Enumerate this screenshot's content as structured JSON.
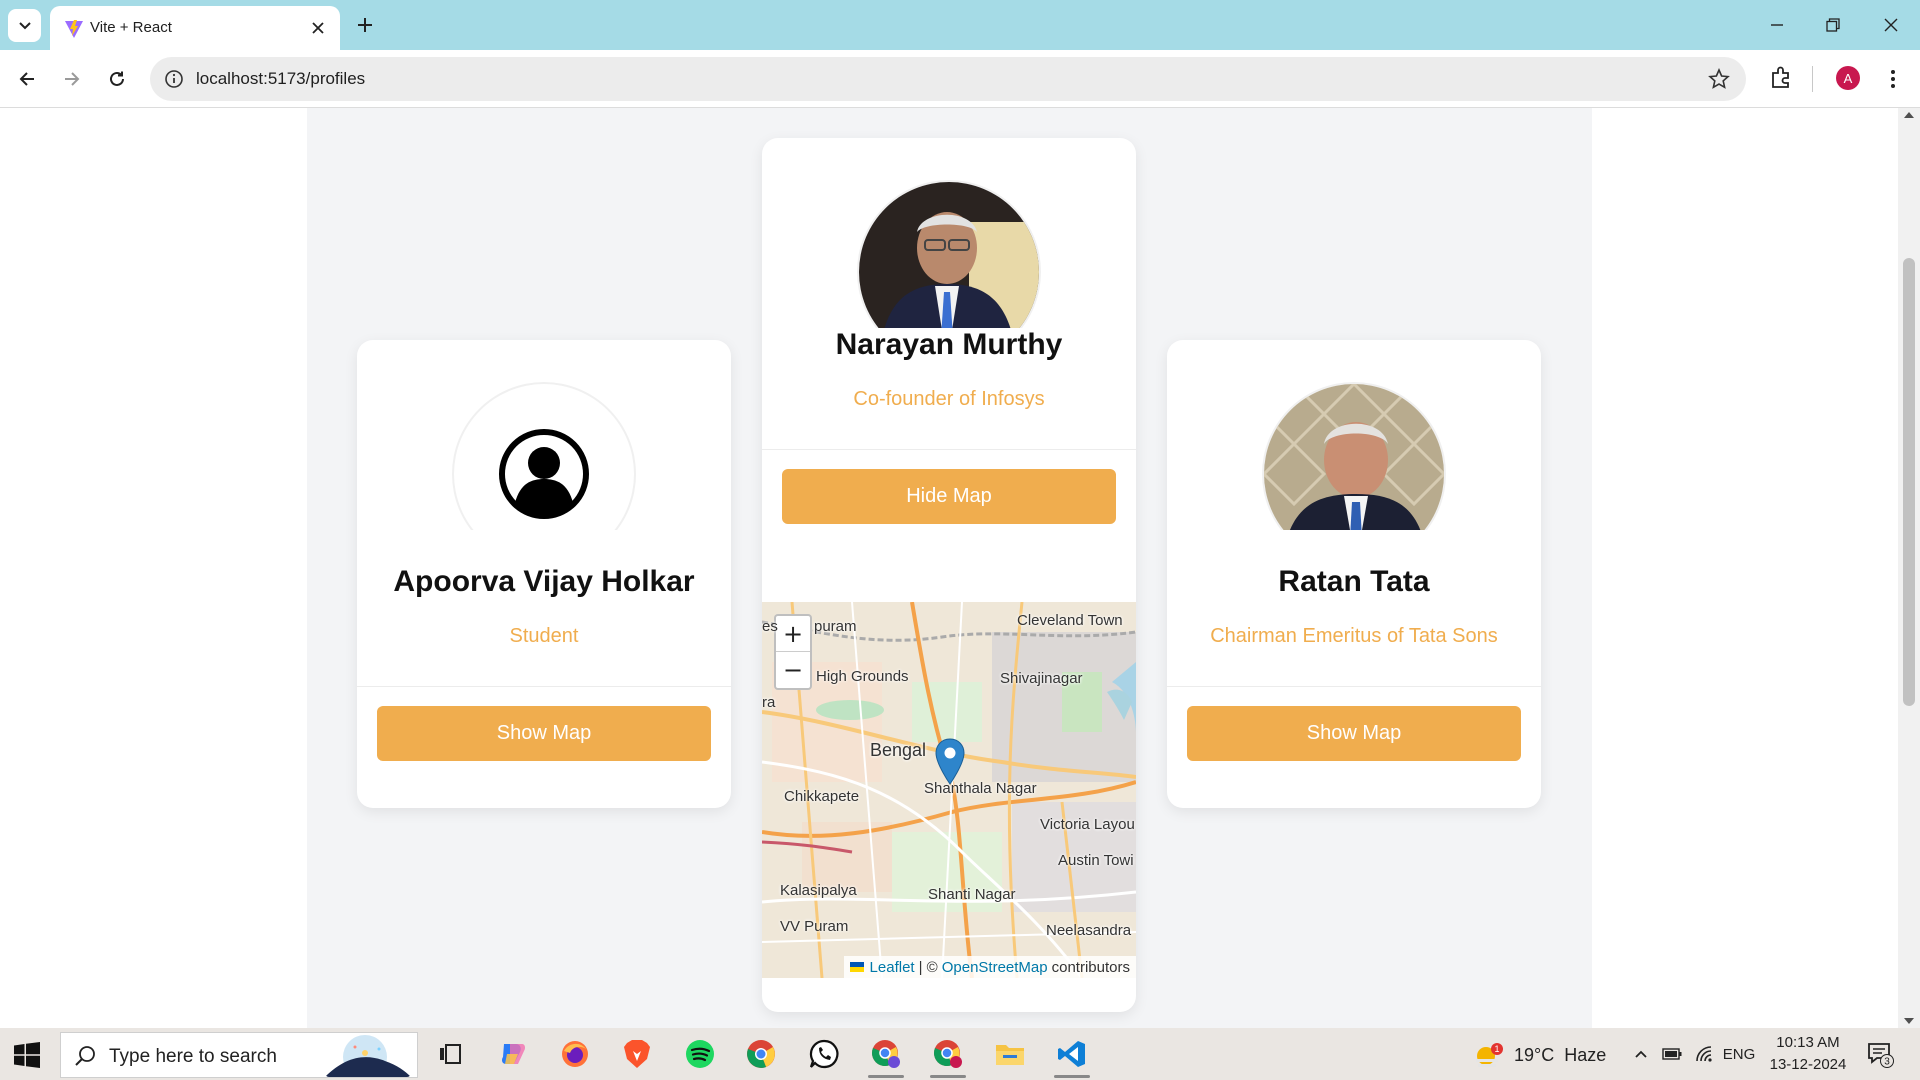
{
  "browser": {
    "tab_title": "Vite + React",
    "url": "localhost:5173/profiles",
    "profile_initial": "A"
  },
  "profiles": [
    {
      "name": "Apoorva Vijay Holkar",
      "role": "Student",
      "button_label": "Show Map",
      "photo": "default-user-icon",
      "map_visible": false
    },
    {
      "name": "Narayan Murthy",
      "role": "Co-founder of Infosys",
      "button_label": "Hide Map",
      "photo": "portrait-photo",
      "map_visible": true
    },
    {
      "name": "Ratan Tata",
      "role": "Chairman Emeritus of Tata Sons",
      "button_label": "Show Map",
      "photo": "portrait-photo",
      "map_visible": false
    }
  ],
  "map": {
    "zoom_in": "+",
    "zoom_out": "−",
    "labels": [
      "puram",
      "Cleveland Town",
      "High Grounds",
      "Shivajinagar",
      "Bengal",
      "Shanthala Nagar",
      "Chikkapete",
      "Victoria Layou",
      "Austin Towi",
      "Kalasipalya",
      "Shanti Nagar",
      "VV Puram",
      "Neelasandra",
      "es",
      "ra"
    ],
    "attribution_leaflet": "Leaflet",
    "attribution_sep": "| ©",
    "attribution_osm": "OpenStreetMap",
    "attribution_suffix": "contributors"
  },
  "taskbar": {
    "search_placeholder": "Type here to search",
    "weather": "19°C  Haze",
    "weather_badge": "1",
    "language": "ENG",
    "time": "10:13 AM",
    "date": "13-12-2024",
    "notification_count": "3"
  },
  "colors": {
    "accent": "#f0ad4e",
    "titlebar": "#a5dbe6",
    "page_bg": "#f3f4f6"
  }
}
